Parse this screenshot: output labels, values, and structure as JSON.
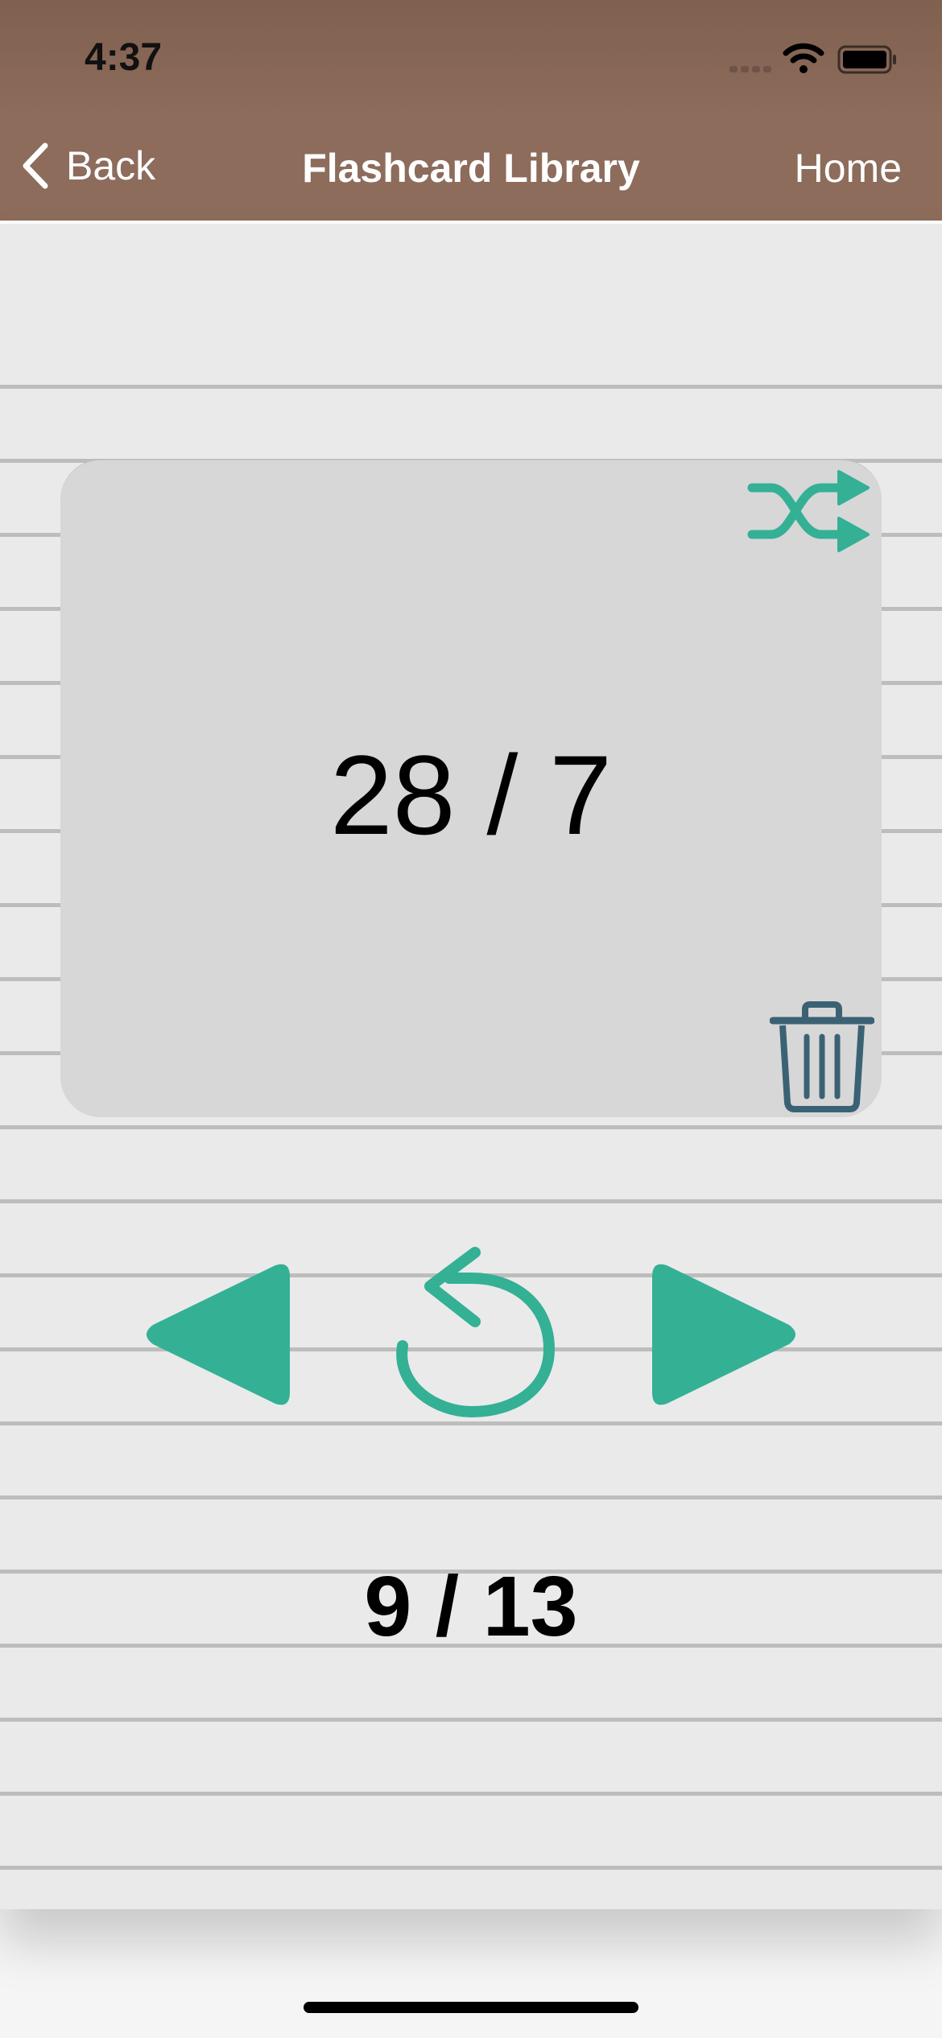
{
  "status_bar": {
    "time": "4:37"
  },
  "nav": {
    "back_label": "Back",
    "title": "Flashcard Library",
    "home_label": "Home"
  },
  "card": {
    "text": "28 / 7"
  },
  "counter": "9 / 13",
  "icons": {
    "shuffle": "shuffle-icon",
    "trash": "trash-icon",
    "prev": "play-left-icon",
    "flip": "rotate-left-icon",
    "next": "play-right-icon"
  },
  "colors": {
    "header": "#8d6c5c",
    "accent": "#34b095",
    "trash": "#3b6274",
    "card": "#d7d7d7",
    "page": "#eaeaea"
  }
}
